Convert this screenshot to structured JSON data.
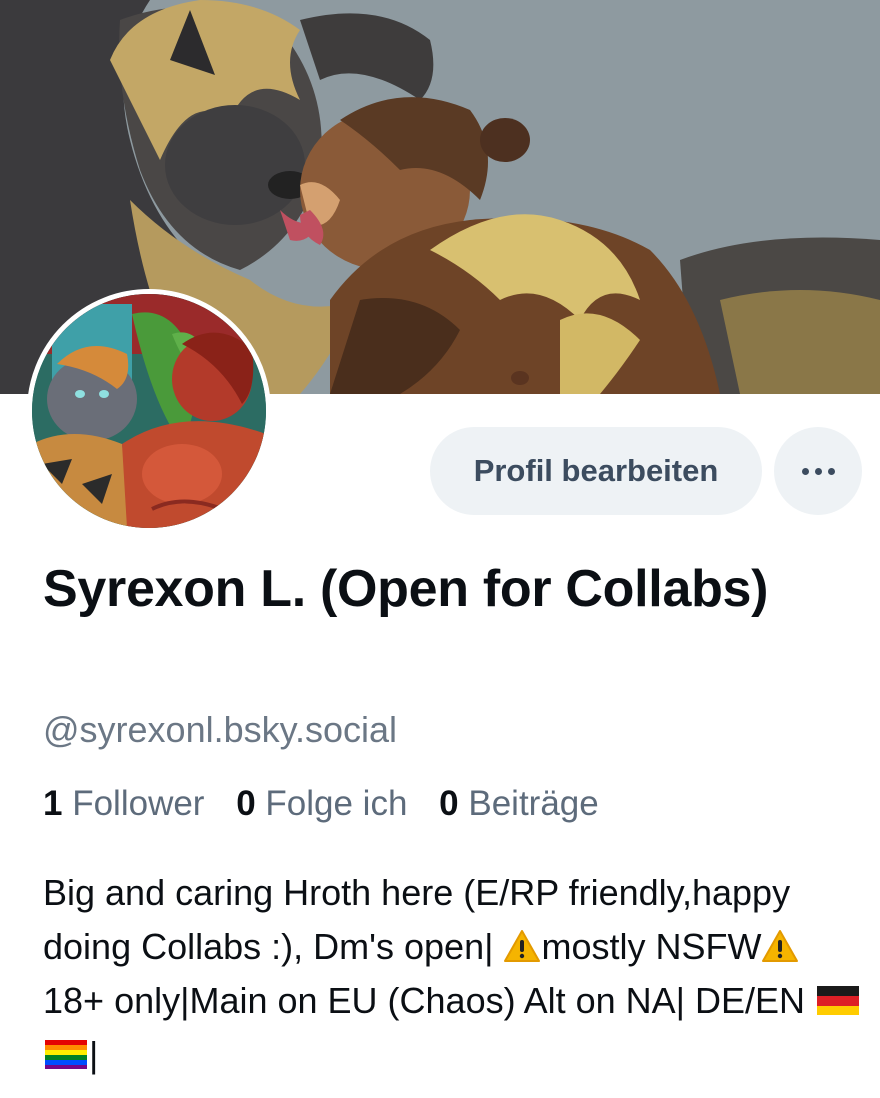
{
  "profile": {
    "display_name": "Syrexon L. (Open for Collabs)",
    "handle": "@syrexonl.bsky.social",
    "banner": "banner-artwork",
    "avatar": "avatar-artwork"
  },
  "actions": {
    "edit_label": "Profil bearbeiten",
    "more_icon": "more-horizontal-icon"
  },
  "stats": {
    "followers_count": "1",
    "followers_label": "Follower",
    "following_count": "0",
    "following_label": "Folge ich",
    "posts_count": "0",
    "posts_label": "Beiträge"
  },
  "bio": {
    "part1": "Big and caring Hroth here (E/RP friendly,happy doing Collabs :), Dm's open| ",
    "part2": "mostly NSFW",
    "part3": " 18+ only|Main on EU (Chaos) Alt on NA| DE/EN ",
    "part4": "|",
    "icons": [
      "warning-icon",
      "flag-germany-icon",
      "flag-rainbow-icon"
    ]
  },
  "colors": {
    "button_bg": "#eef2f5",
    "button_text": "#3c4c5f",
    "secondary_text": "#5d6b7b",
    "primary_text": "#0b0f14"
  }
}
